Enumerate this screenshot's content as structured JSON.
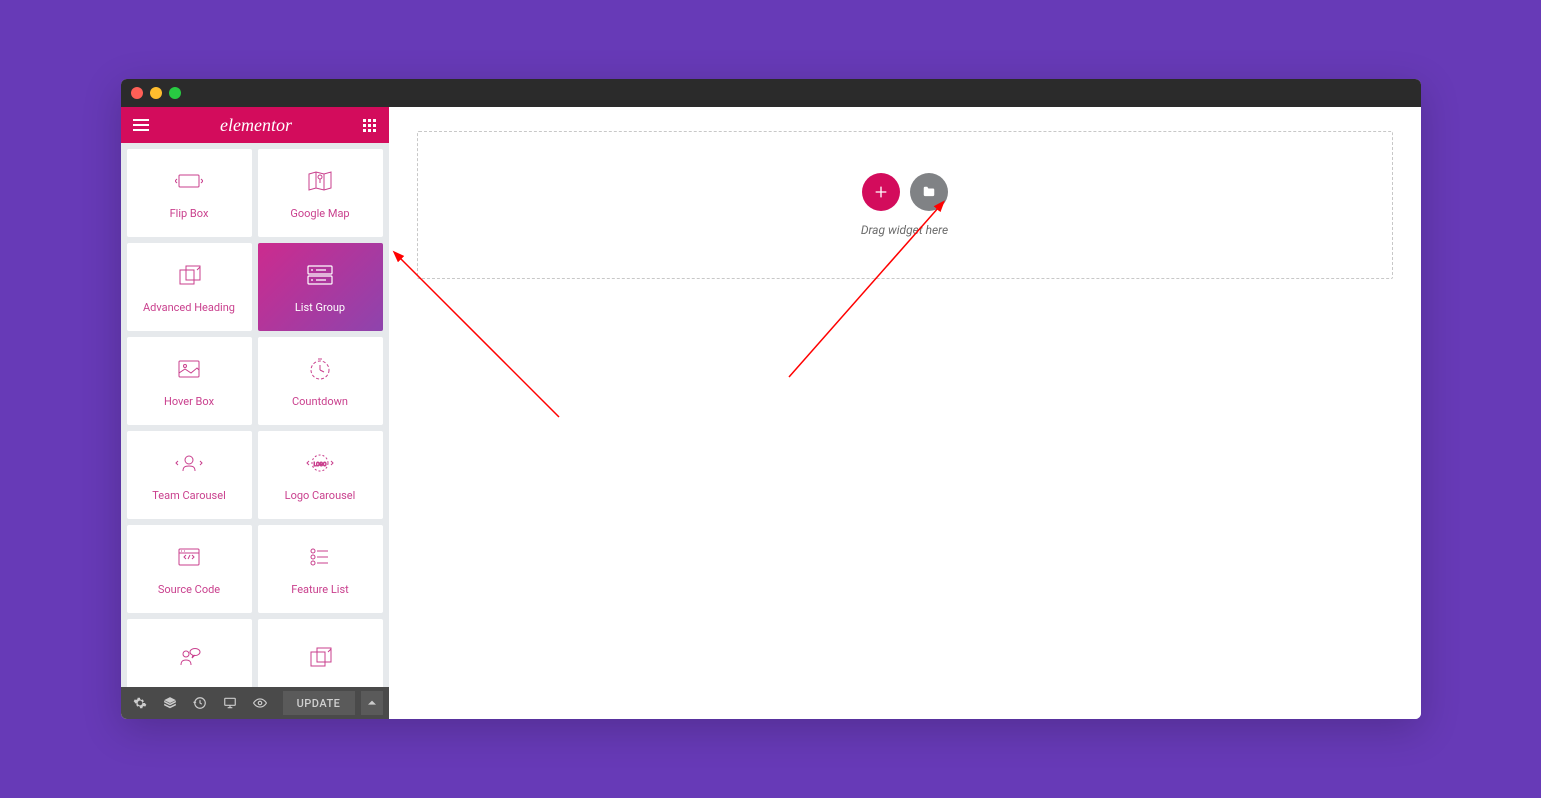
{
  "app": {
    "name": "elementor"
  },
  "colors": {
    "accent": "#d30c5c",
    "purple_bg": "#673ab7"
  },
  "sidebar": {
    "widgets": [
      {
        "label": "Flip Box",
        "icon": "flip-box"
      },
      {
        "label": "Google Map",
        "icon": "google-map"
      },
      {
        "label": "Advanced Heading",
        "icon": "advanced-heading"
      },
      {
        "label": "List Group",
        "icon": "list-group",
        "active": true
      },
      {
        "label": "Hover Box",
        "icon": "hover-box"
      },
      {
        "label": "Countdown",
        "icon": "countdown"
      },
      {
        "label": "Team Carousel",
        "icon": "team-carousel"
      },
      {
        "label": "Logo Carousel",
        "icon": "logo-carousel"
      },
      {
        "label": "Source Code",
        "icon": "source-code"
      },
      {
        "label": "Feature List",
        "icon": "feature-list"
      },
      {
        "label": "",
        "icon": "testimonial"
      },
      {
        "label": "",
        "icon": "advanced-toggle"
      }
    ],
    "footer": {
      "update_label": "UPDATE"
    }
  },
  "canvas": {
    "drop_hint": "Drag widget here"
  }
}
